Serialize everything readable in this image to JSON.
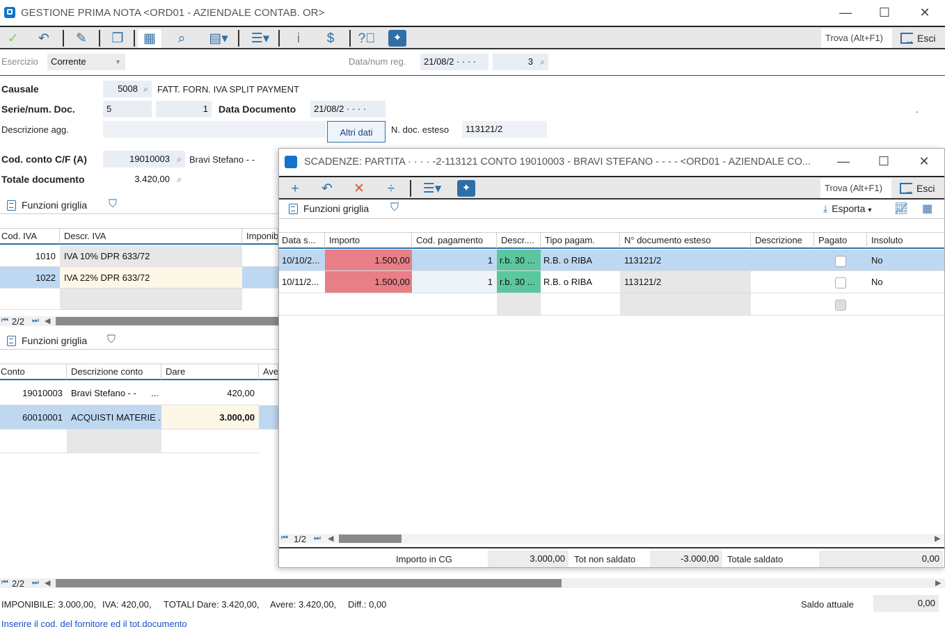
{
  "window": {
    "title": "GESTIONE PRIMA NOTA <ORD01 - AZIENDALE CONTAB. OR>",
    "minimize": "—",
    "maximize": "☐",
    "close": "✕"
  },
  "toolbar": {
    "find_label": "Trova (Alt+F1)",
    "exit_label": "Esci"
  },
  "header": {
    "esercizio_label": "Esercizio",
    "esercizio_value": "Corrente",
    "data_num_label": "Data/num reg.",
    "data_value": "21/08/2 · · · ·",
    "num_value": "3"
  },
  "doc": {
    "causale_label": "Causale",
    "causale_code": "5008",
    "causale_desc": "FATT. FORN. IVA SPLIT PAYMENT",
    "serie_label": "Serie/num. Doc.",
    "serie_value": "5",
    "num_doc_value": "1",
    "data_doc_label": "Data Documento",
    "data_doc_value": "21/08/2 · · · ·",
    "dot": ".",
    "descr_agg_label": "Descrizione agg.",
    "altri_dati_label": "Altri dati",
    "n_doc_esteso_label": "N. doc. esteso",
    "n_doc_esteso_value": "113121/2",
    "cod_conto_label": "Cod. conto C/F  (A)",
    "cod_conto_value": "19010003",
    "cod_conto_name": "Bravi Stefano  -  -",
    "totale_label": "Totale documento",
    "totale_value": "3.420,00"
  },
  "grid_iva": {
    "funzioni_label": "Funzioni griglia",
    "headers": [
      "Cod. IVA",
      "Descr. IVA",
      "Imponib"
    ],
    "rows": [
      {
        "cod": "1010",
        "descr": "IVA 10% DPR 633/72"
      },
      {
        "cod": "1022",
        "descr": "IVA 22% DPR 633/72"
      }
    ],
    "pager": "2/2"
  },
  "grid_conti": {
    "funzioni_label": "Funzioni griglia",
    "headers": [
      "Conto",
      "Descrizione conto",
      "Dare",
      "Ave"
    ],
    "rows": [
      {
        "conto": "19010003",
        "descr": "Bravi Stefano  -  -",
        "more": "...",
        "dare": "420,00"
      },
      {
        "conto": "60010001",
        "descr": "ACQUISTI MATERIE ...",
        "more": "",
        "dare": "3.000,00"
      }
    ],
    "pager": "2/2"
  },
  "footer": {
    "imponibile": "IMPONIBILE: 3.000,00,",
    "iva": "IVA: 420,00,",
    "totali": "TOTALI Dare: 3.420,00,",
    "avere": "Avere: 3.420,00,",
    "diff": "Diff.: 0,00",
    "saldo_label": "Saldo attuale",
    "saldo_value": "0,00",
    "hint": "Inserire il cod. del fornitore ed il tot.documento"
  },
  "modal": {
    "title": "SCADENZE: PARTITA · · · ·   -2-113121 CONTO 19010003 - BRAVI STEFANO  -  -     -  -  <ORD01 - AZIENDALE CO...",
    "find_label": "Trova (Alt+F1)",
    "exit_label": "Esci",
    "funzioni_label": "Funzioni griglia",
    "esporta_label": "Esporta",
    "headers": [
      "Data s...",
      "Importo",
      "Cod. pagamento",
      "Descr....",
      "Tipo pagam.",
      "N° documento esteso",
      "Descrizione",
      "Pagato",
      "Insoluto"
    ],
    "rows": [
      {
        "data": "10/10/2...",
        "importo": "1.500,00",
        "cod_pag": "1",
        "descr": "r.b. 30 ...",
        "tipo": "R.B. o RIBA",
        "ndoc": "113121/2",
        "insoluto": "No"
      },
      {
        "data": "10/11/2...",
        "importo": "1.500,00",
        "cod_pag": "1",
        "descr": "r.b. 30 ...",
        "tipo": "R.B. o RIBA",
        "ndoc": "113121/2",
        "insoluto": "No"
      }
    ],
    "pager": "1/2",
    "importo_cg_label": "Importo in CG",
    "importo_cg_value": "3.000,00",
    "tot_non_saldato_label": "Tot non saldato",
    "tot_non_saldato_value": "-3.000,00",
    "totale_saldato_label": "Totale saldato",
    "totale_saldato_value": "0,00"
  }
}
